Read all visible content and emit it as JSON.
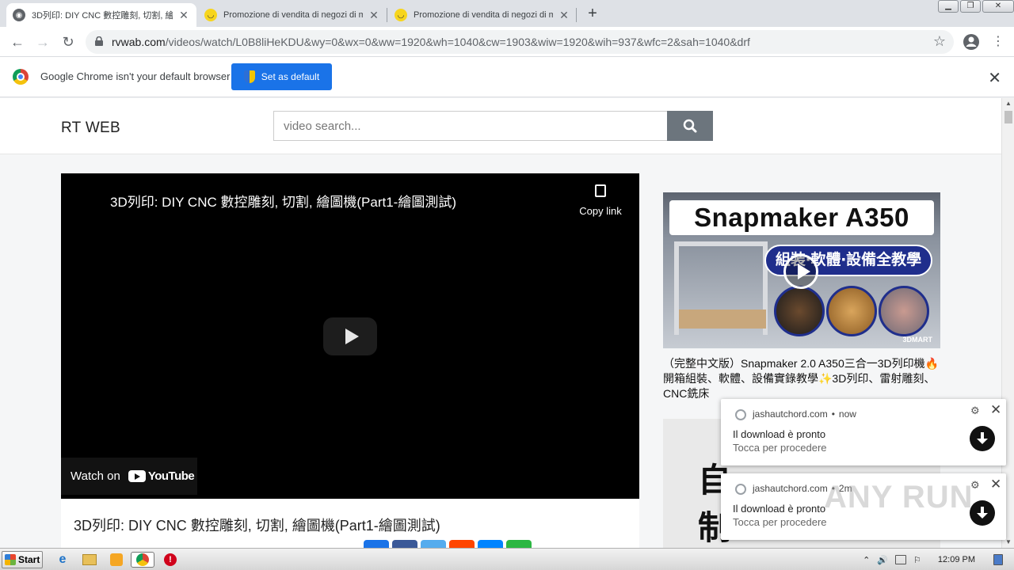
{
  "browser": {
    "tabs": [
      {
        "title": "3D列印: DIY CNC 數控雕刻, 切割, 繪",
        "active": true,
        "favicon": "globe-icon"
      },
      {
        "title": "Promozione di vendita di negozi di m",
        "active": false,
        "favicon": "smiley-icon"
      },
      {
        "title": "Promozione di vendita di negozi di m",
        "active": false,
        "favicon": "smiley-icon"
      }
    ],
    "new_tab": "+",
    "close_glyph": "✕",
    "url_host": "rvwab.com",
    "url_path": "/videos/watch/L0B8liHeKDU&wy=0&wx=0&ww=1920&wh=1040&cw=1903&wiw=1920&wih=937&wfc=2&sah=1040&drf"
  },
  "infobar": {
    "message": "Google Chrome isn't your default browser",
    "button": "Set as default"
  },
  "site": {
    "brand": "RT WEB",
    "search_placeholder": "video search..."
  },
  "video": {
    "title": "3D列印: DIY CNC 數控雕刻, 切割, 繪圖機(Part1-繪圖測試)",
    "copy_link": "Copy link",
    "watch_on": "Watch on",
    "youtube": "YouTube",
    "page_title": "3D列印: DIY CNC 數控雕刻, 切割, 繪圖機(Part1-繪圖測試)"
  },
  "share_colors": [
    "#1a73e8",
    "#3b5998",
    "#55acee",
    "#ff4500",
    "#0084ff",
    "#2cb742"
  ],
  "sidebar": {
    "thumb1_title": "Snapmaker A350",
    "thumb1_sub": "組裝‧軟體‧設備全教學",
    "thumb1_brand": "3DMART",
    "caption1": "（完整中文版）Snapmaker 2.0 A350三合一3D列印機🔥開箱組裝、軟體、設備實錄教學✨3D列印、雷射雕刻、CNC銑床",
    "thumb2_chars": [
      "自",
      "制"
    ]
  },
  "notifications": [
    {
      "source": "jashautchord.com",
      "time": "now",
      "heading": "Il download è pronto",
      "body": "Tocca per procedere"
    },
    {
      "source": "jashautchord.com",
      "time": "2m",
      "heading": "Il download è pronto",
      "body": "Tocca per procedere"
    }
  ],
  "watermark": "ANY RUN",
  "taskbar": {
    "start": "Start",
    "clock": "12:09 PM"
  }
}
